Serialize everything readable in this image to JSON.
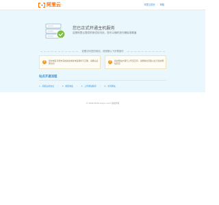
{
  "brand": {
    "name": "阿里云",
    "color": "#ff6a00"
  },
  "header": {
    "links": [
      {
        "label": "阿里云首页"
      },
      {
        "label": "邮箱"
      }
    ]
  },
  "hero": {
    "icon": "server-check-icon",
    "title": "您已正式开通主机服务",
    "subtitle": "这是阿里云提供的测试访问页，您可以随时进行删除或覆盖"
  },
  "notice": {
    "text": "如需访问您的网站，请按照以下步骤操作"
  },
  "tips": [
    {
      "icon": "warning-icon",
      "text": "您的域名可能未完成备案或者域名解析不正确，请确认后再访问"
    },
    {
      "icon": "warning-icon",
      "text": "您的网站内容已上传至空间，请删除此页面以显示您的网站首页"
    }
  ],
  "steps": {
    "title": "站点开通流程",
    "items": [
      {
        "num": "1",
        "label": "获取主机信息"
      },
      {
        "num": "2",
        "label": "绑定域名"
      },
      {
        "num": "3",
        "label": "上传网站程序"
      },
      {
        "num": "4",
        "label": "访问网站"
      }
    ]
  },
  "footer": {
    "text": "© 2009-2019 Aliyun.com 版权所有"
  },
  "colors": {
    "hero_bg": "#eaf7fc",
    "link": "#3b8fd9",
    "warning": "#f59a23",
    "check": "#7cc142"
  }
}
